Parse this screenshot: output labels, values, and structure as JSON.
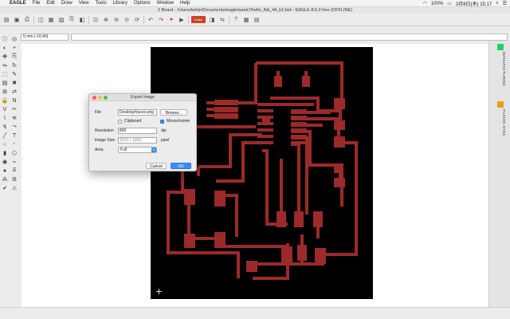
{
  "menubar": {
    "app": "EAGLE",
    "items": [
      "File",
      "Edit",
      "Draw",
      "View",
      "Tools",
      "Library",
      "Options",
      "Window",
      "Help"
    ],
    "battery": "100%",
    "datetime": "3月8日(木) 15:17"
  },
  "window": {
    "title": "2 Board - /Users/kehjn/Documents/eagle/week7/hello_ftdi_44_k2.brd - EAGLE 8.6.3 free (OFFLINE)"
  },
  "toolbar": {
    "logo_text": "make"
  },
  "command": {
    "coord": "5 mm (-10.40)",
    "value": ""
  },
  "right_panel": {
    "manufacturing": "MANUFACTURING",
    "fusion_sync": "FUSION SYNC"
  },
  "dialog": {
    "title": "Export Image",
    "file_label": "File",
    "file_value": "Desktop/traces.png",
    "browse_label": "Browse...",
    "clipboard_label": "Clipboard",
    "clipboard_checked": false,
    "monochrome_label": "Monochrome",
    "monochrome_checked": true,
    "resolution_label": "Resolution",
    "resolution_value": "800",
    "resolution_unit": "dpi",
    "image_size_label": "Image Size",
    "image_size_value": "1150 x 1300",
    "image_size_unit": "pixel",
    "area_label": "Area",
    "area_value": "Full",
    "cancel_label": "Cancel",
    "ok_label": "OK"
  },
  "colors": {
    "trace": "#9b2a2a",
    "board_bg": "#000000",
    "accent": "#3b8ef0"
  }
}
